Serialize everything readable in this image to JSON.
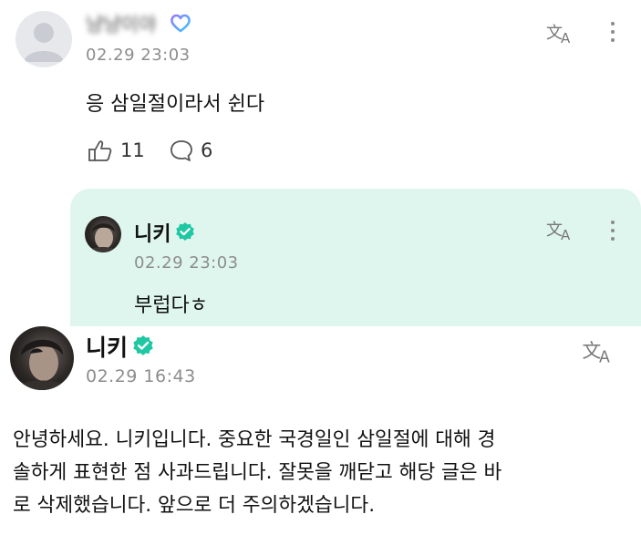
{
  "comment": {
    "username": "냥냥이야",
    "timestamp": "02.29 23:03",
    "text": "응 삼일절이라서 쉰다",
    "like_count": "11",
    "reply_count": "6"
  },
  "reply": {
    "username": "니키",
    "timestamp": "02.29 23:03",
    "text": "부럽다ㅎ"
  },
  "post": {
    "username": "니키",
    "timestamp": "02.29 16:43",
    "text_lines": [
      "안녕하세요. 니키입니다. 중요한 국경일인 삼일절에 대해 경",
      "솔하게 표현한 점 사과드립니다. 잘못을 깨닫고 해당 글은 바",
      "로 삭제했습니다. 앞으로 더 주의하겠습니다."
    ]
  },
  "icons": {
    "translate": "translate-icon",
    "more": "more-vertical-icon",
    "verified": "verified-badge-icon",
    "heart": "heart-icon",
    "like": "like-hand-icon",
    "comment": "comment-bubble-icon"
  },
  "colors": {
    "verified": "#1fc7a3",
    "membership_heart_start": "#8e7bff",
    "membership_heart_end": "#3fc4ff",
    "reply_background": "#dff6ee",
    "timestamp": "#8d8d8d"
  }
}
